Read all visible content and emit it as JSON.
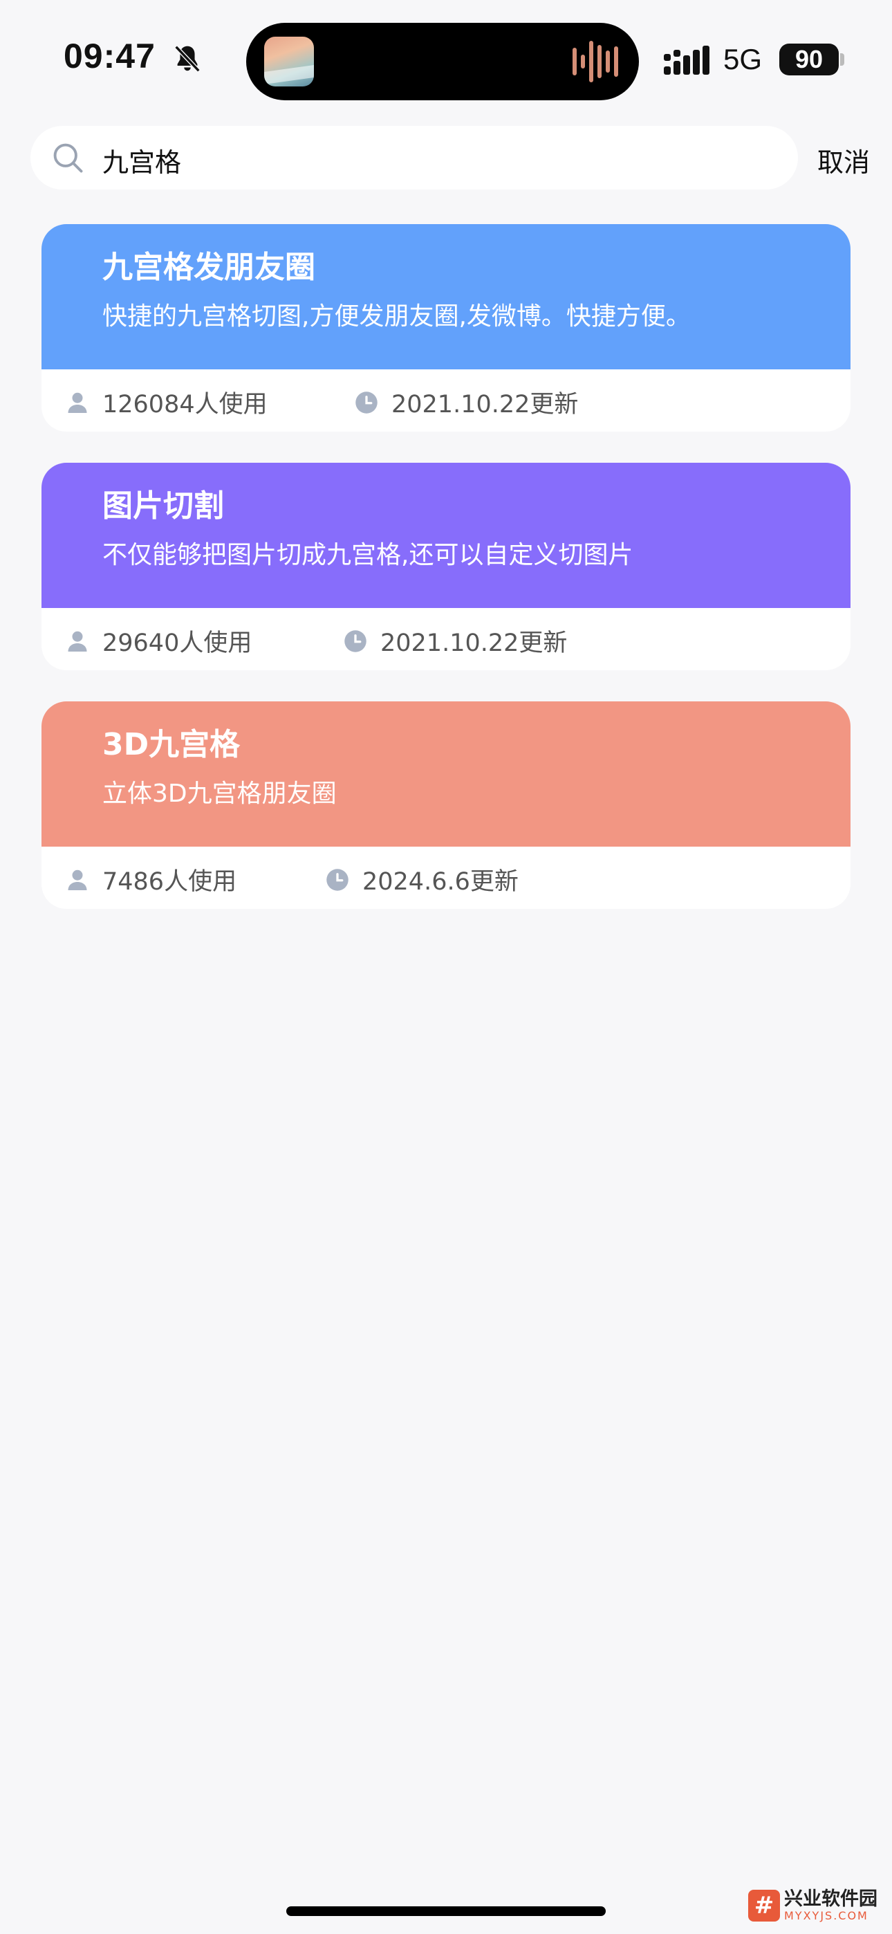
{
  "status_bar": {
    "time": "09:47",
    "network": "5G",
    "battery": "90",
    "icons": [
      "bell-slash-icon",
      "now-playing-art",
      "waveform-icon",
      "signal-icon"
    ]
  },
  "search": {
    "query": "九宫格",
    "cancel_label": "取消"
  },
  "cards": [
    {
      "title": "九宫格发朋友圈",
      "description": "快捷的九宫格切图,方便发朋友圈,发微博。快捷方便。",
      "users": "126084人使用",
      "updated": "2021.10.22更新",
      "color": "#62a1fb"
    },
    {
      "title": "图片切割",
      "description": "不仅能够把图片切成九宫格,还可以自定义切图片",
      "users": "29640人使用",
      "updated": "2021.10.22更新",
      "color": "#876dfb"
    },
    {
      "title": "3D九宫格",
      "description": "立体3D九宫格朋友圈",
      "users": "7486人使用",
      "updated": "2024.6.6更新",
      "color": "#f29683"
    }
  ],
  "watermark": {
    "logo": "#",
    "name": "兴业软件园",
    "domain": "MYXYJS.COM"
  }
}
